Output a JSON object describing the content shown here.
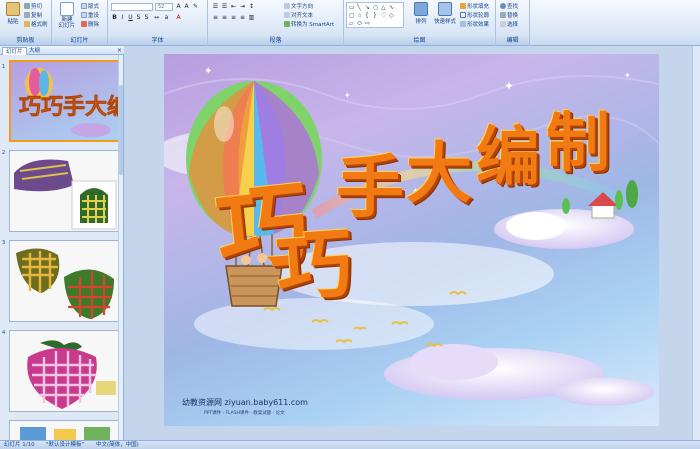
{
  "ribbon": {
    "clipboard": {
      "paste": "粘贴",
      "cut": "剪切",
      "copy": "复制",
      "format_painter": "格式刷",
      "label": "剪贴板"
    },
    "slides": {
      "new_slide": "新建\n幻灯片",
      "layout": "版式",
      "reset": "重设",
      "delete": "删除",
      "label": "幻灯片"
    },
    "font": {
      "font_size": "52",
      "label": "字体"
    },
    "paragraph": {
      "text_direction": "文字方向",
      "align_text": "对齐文本",
      "smartart": "转换为 SmartArt",
      "label": "段落"
    },
    "drawing": {
      "arrange": "排列",
      "quick_styles": "快速样式",
      "shape_fill": "形状填充",
      "shape_outline": "形状轮廓",
      "shape_effects": "形状效果",
      "label": "绘图"
    },
    "editing": {
      "find": "查找",
      "replace": "替换",
      "select": "选择",
      "label": "编辑"
    }
  },
  "panel": {
    "tab_slides": "幻灯片",
    "tab_outline": "大纲",
    "close": "×",
    "thumbnails": [
      {
        "num": "1"
      },
      {
        "num": "2"
      },
      {
        "num": "3"
      },
      {
        "num": "4"
      }
    ]
  },
  "slide": {
    "title_chars": [
      "巧",
      "巧",
      "手",
      "大",
      "编",
      "制"
    ],
    "footer": "幼教资源网 ziyuan.baby611.com",
    "footer_sub": "PPT课件 · FLASH课件 · 教案试题 · 论文"
  },
  "status": {
    "slide_count": "幻灯片 1/10",
    "theme": "\"默认设计模板\"",
    "language": "中文(简体，中国)"
  },
  "colors": {
    "accent": "#f27a12",
    "ribbon": "#dbe7f6",
    "selection": "#f29b1d"
  }
}
